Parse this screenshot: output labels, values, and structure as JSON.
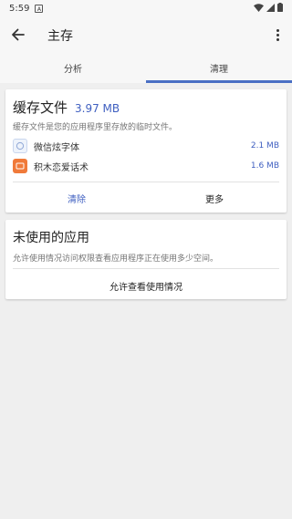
{
  "status_bar": {
    "time": "5:59",
    "badge": "A"
  },
  "app_bar": {
    "title": "主存"
  },
  "tabs": [
    {
      "label": "分析",
      "active": false
    },
    {
      "label": "清理",
      "active": true
    }
  ],
  "cache_card": {
    "title": "缓存文件",
    "size": "3.97 MB",
    "description": "缓存文件是您的应用程序里存放的临时文件。",
    "apps": [
      {
        "name": "微信炫字体",
        "size": "2.1 MB",
        "icon": "font-app-icon"
      },
      {
        "name": "积木恋爱话术",
        "size": "1.6 MB",
        "icon": "love-app-icon"
      }
    ],
    "clear_label": "清除",
    "more_label": "更多"
  },
  "unused_card": {
    "title": "未使用的应用",
    "description": "允许使用情况访问权限查看应用程序正在使用多少空间。",
    "allow_label": "允许查看使用情况"
  },
  "colors": {
    "accent": "#3f5fc0",
    "tab_indicator": "#4a6fc4",
    "background": "#efefef"
  }
}
